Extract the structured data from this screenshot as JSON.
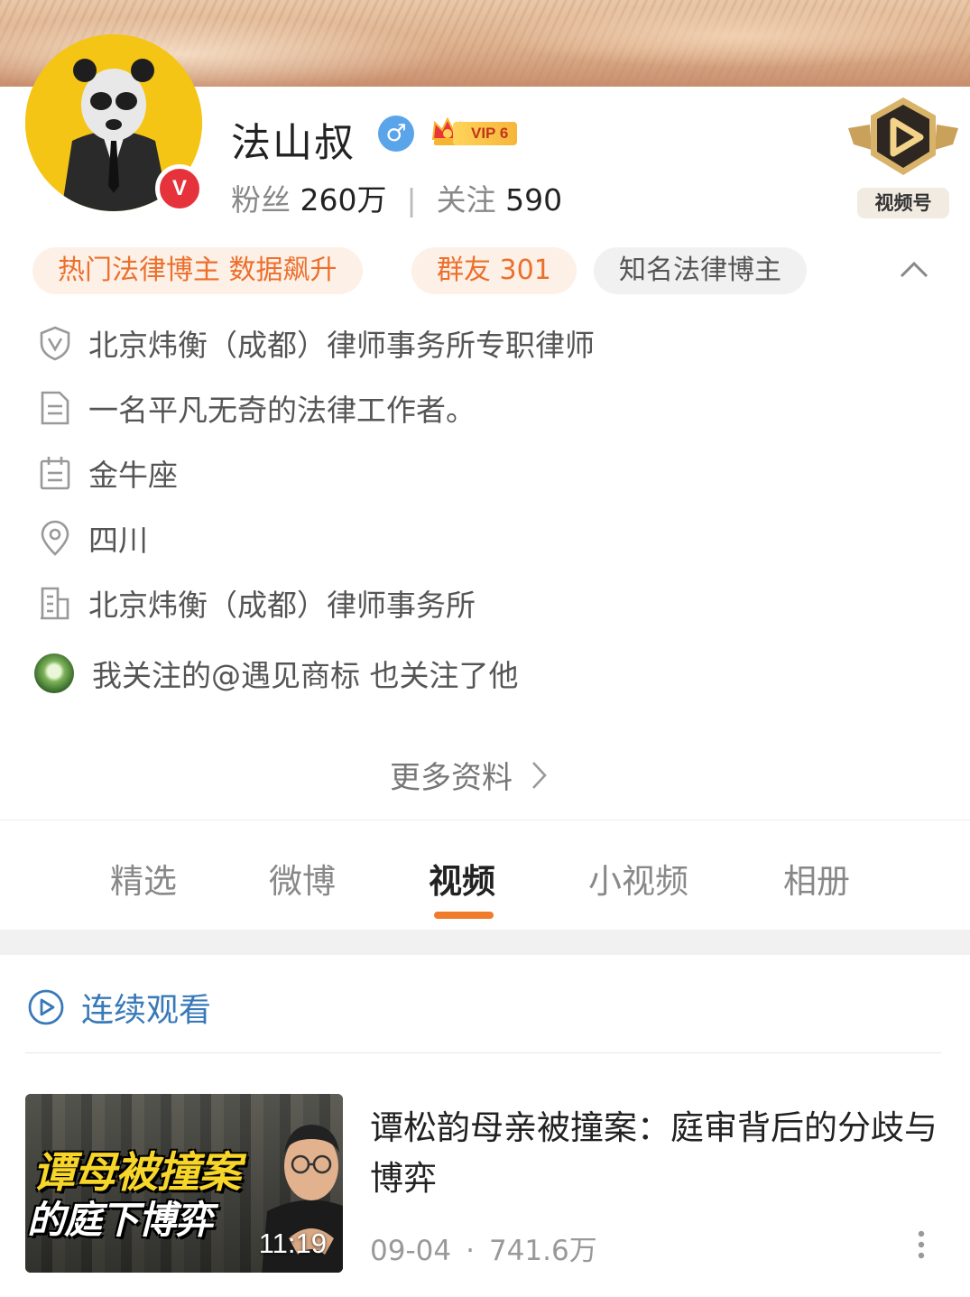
{
  "profile": {
    "name": "法山叔",
    "gender_icon": "♂",
    "vip_label": "VIP 6",
    "verified_mark": "V",
    "fans_label": "粉丝",
    "fans_count": "260万",
    "stats_separator": "|",
    "following_label": "关注",
    "following_count": "590",
    "video_channel_label": "视频号"
  },
  "tags": {
    "hot": "热门法律博主 数据飙升",
    "group": "群友 301",
    "known": "知名法律博主"
  },
  "info": {
    "verification": "北京炜衡（成都）律师事务所专职律师",
    "bio": "一名平凡无奇的法律工作者。",
    "zodiac": "金牛座",
    "location": "四川",
    "company": "北京炜衡（成都）律师事务所",
    "mutual_follow": "我关注的@遇见商标 也关注了他"
  },
  "more_info_label": "更多资料",
  "tabs": {
    "featured": "精选",
    "weibo": "微博",
    "video": "视频",
    "short_video": "小视频",
    "album": "相册",
    "active": "视频"
  },
  "continue_watch_label": "连续观看",
  "video": {
    "thumb_title_line1": "谭母被撞案",
    "thumb_title_line2": "的庭下博弈",
    "duration": "11:19",
    "title": "谭松韵母亲被撞案：庭审背后的分歧与博弈",
    "date": "09-04",
    "meta_dot": "·",
    "views": "741.6万"
  },
  "colors": {
    "accent_orange": "#f07b2a",
    "tag_orange": "#ec6f2b",
    "link_blue": "#3879b8",
    "verified_red": "#e6323a",
    "avatar_yellow": "#f4c514"
  }
}
